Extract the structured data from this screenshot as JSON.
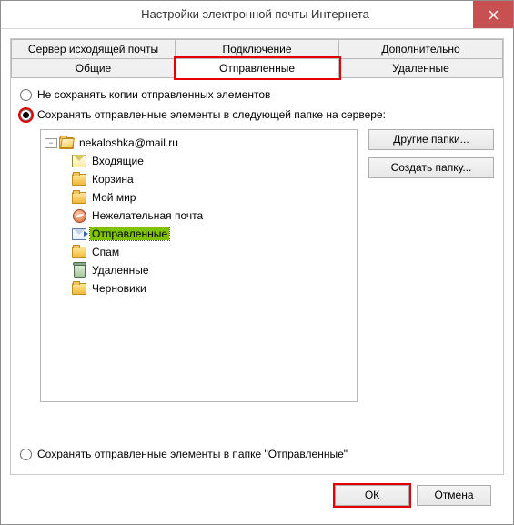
{
  "window": {
    "title": "Настройки электронной почты Интернета"
  },
  "tabs": {
    "row1": [
      {
        "label": "Сервер исходящей почты"
      },
      {
        "label": "Подключение"
      },
      {
        "label": "Дополнительно"
      }
    ],
    "row2": [
      {
        "label": "Общие"
      },
      {
        "label": "Отправленные",
        "active": true
      },
      {
        "label": "Удаленные"
      }
    ]
  },
  "options": {
    "dont_save": "Не сохранять копии отправленных элементов",
    "save_in_folder": "Сохранять отправленные элементы в следующей папке на сервере:",
    "save_default": "Сохранять отправленные элементы в папке \"Отправленные\""
  },
  "tree": {
    "root": "nekaloshka@mail.ru",
    "children": [
      "Входящие",
      "Корзина",
      "Мой мир",
      "Нежелательная почта",
      "Отправленные",
      "Спам",
      "Удаленные",
      "Черновики"
    ],
    "selected": "Отправленные"
  },
  "side_buttons": {
    "other": "Другие папки...",
    "create": "Создать папку..."
  },
  "dialog_buttons": {
    "ok": "ОК",
    "cancel": "Отмена"
  },
  "tree_icons": [
    "inbox",
    "folder",
    "folder",
    "junk",
    "sent",
    "folder",
    "trash",
    "folder"
  ]
}
